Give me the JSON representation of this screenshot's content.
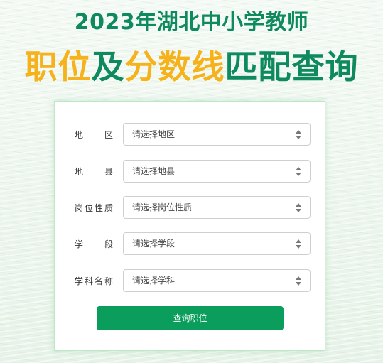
{
  "header": {
    "title_line1": "2023年湖北中小学教师",
    "title_line2_parts": [
      "职位",
      "及",
      "分数线",
      "匹配查询"
    ]
  },
  "form": {
    "fields": [
      {
        "label": "地区",
        "placeholder": "请选择地区"
      },
      {
        "label": "地县",
        "placeholder": "请选择地县"
      },
      {
        "label": "岗位性质",
        "placeholder": "请选择岗位性质"
      },
      {
        "label": "学段",
        "placeholder": "请选择学段"
      },
      {
        "label": "学科名称",
        "placeholder": "请选择学科"
      }
    ],
    "submit_label": "查询职位"
  },
  "colors": {
    "brand_green": "#0f8a5f",
    "accent_yellow": "#f6b21b",
    "button_green": "#0b9d5c"
  },
  "icons": {
    "select_arrow": "updown-arrow-icon"
  }
}
